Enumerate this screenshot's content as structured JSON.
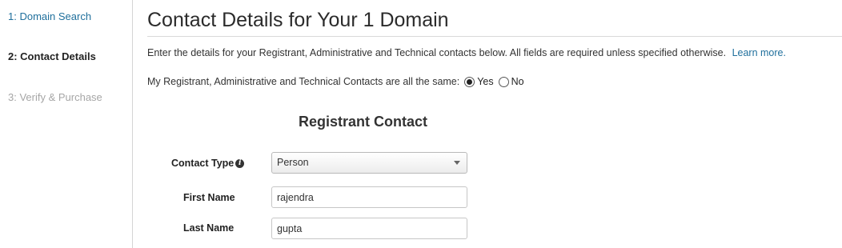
{
  "steps": [
    {
      "label": "1: Domain Search",
      "state": "link"
    },
    {
      "label": "2: Contact Details",
      "state": "active"
    },
    {
      "label": "3: Verify & Purchase",
      "state": "disabled"
    }
  ],
  "main": {
    "title": "Contact Details for Your 1 Domain",
    "intro": "Enter the details for your Registrant, Administrative and Technical contacts below. All fields are required unless specified otherwise.",
    "learn_more": "Learn more.",
    "same_contacts": {
      "question": "My Registrant, Administrative and Technical Contacts are all the same:",
      "options": [
        {
          "label": "Yes",
          "checked": true
        },
        {
          "label": "No",
          "checked": false
        }
      ]
    }
  },
  "registrant": {
    "heading": "Registrant Contact",
    "contact_type": {
      "label": "Contact Type",
      "value": "Person"
    },
    "first_name": {
      "label": "First Name",
      "value": "rajendra"
    },
    "last_name": {
      "label": "Last Name",
      "value": "gupta"
    }
  },
  "colors": {
    "link": "#1f6f9c",
    "disabled": "#a6a6a6",
    "text": "#222222"
  }
}
